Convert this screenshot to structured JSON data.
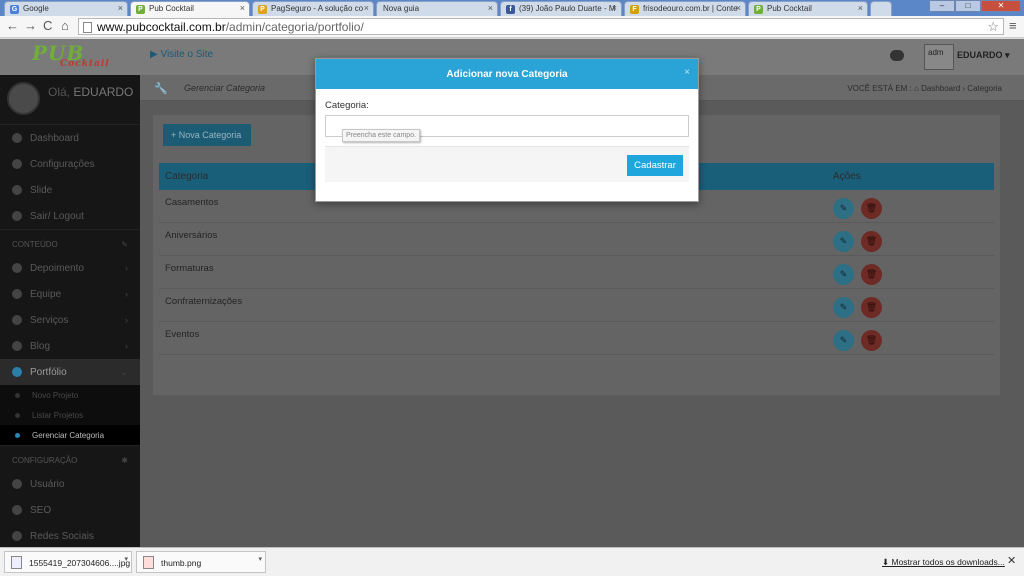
{
  "browser": {
    "tabs": [
      {
        "title": "Google",
        "fav": "G",
        "color": "#4a7fe0"
      },
      {
        "title": "Pub Cocktail",
        "fav": "P",
        "color": "#6fae3a",
        "active": true
      },
      {
        "title": "PagSeguro - A solução co",
        "fav": "P",
        "color": "#e0a020"
      },
      {
        "title": "Nova guia",
        "fav": "",
        "color": "#999"
      },
      {
        "title": "(39) João Paulo Duarte - M",
        "fav": "f",
        "color": "#3b5998"
      },
      {
        "title": "frisodeouro.com.br | Conte",
        "fav": "F",
        "color": "#d4a010"
      },
      {
        "title": "Pub Cocktail",
        "fav": "P",
        "color": "#6fae3a"
      }
    ],
    "tab_close": "×",
    "url_host": "www.pubcocktail.com.br",
    "url_path": "/admin/categoria/portfolio/",
    "back_icon": "←",
    "forward_icon": "→",
    "reload_icon": "C",
    "home_icon": "⌂",
    "star_icon": "☆",
    "menu_icon": "≡",
    "win_min": "–",
    "win_max": "□",
    "win_close": "✕"
  },
  "topnav": {
    "logo": "PUB",
    "logo_sub": "Cocktail",
    "visit_site": "Visite o Site",
    "avatar_alt": "adm",
    "username": "EDUARDO ▾"
  },
  "sidebar": {
    "greeting": "Olá,",
    "name": "EDUARDO",
    "items": [
      {
        "label": "Dashboard"
      },
      {
        "label": "Configurações"
      },
      {
        "label": "Slide"
      },
      {
        "label": "Sair/ Logout"
      }
    ],
    "section_content": "CONTEÚDO",
    "content_items": [
      {
        "label": "Depoimento",
        "chev": "›"
      },
      {
        "label": "Equipe",
        "chev": "›"
      },
      {
        "label": "Serviços",
        "chev": "›"
      },
      {
        "label": "Blog",
        "chev": "›"
      }
    ],
    "portfolio": {
      "label": "Portfólio",
      "chev": "⌄"
    },
    "sub_items": [
      "Novo Projeto",
      "Listar Projetos",
      "Gerenciar Categoria"
    ],
    "section_config": "CONFIGURAÇÃO",
    "config_items": [
      {
        "label": "Usuário"
      },
      {
        "label": "SEO"
      },
      {
        "label": "Redes Sociais"
      }
    ]
  },
  "page": {
    "title": "Gerenciar Categoria",
    "breadcrumb": "VOCÊ ESTÁ EM :  ⌂ Dashboard  ›  Categoria",
    "new_button": "+ Nova Categoria",
    "table": {
      "headers": [
        "Categoria",
        "Ações"
      ],
      "rows": [
        "Casamentos",
        "Aniversários",
        "Formaturas",
        "Confraternizações",
        "Eventos"
      ]
    },
    "edit_icon": "✎",
    "delete_icon": "🗑"
  },
  "modal": {
    "title": "Adicionar nova Categoria",
    "close": "×",
    "label": "Categoria:",
    "input_value": "",
    "tooltip": "Preencha este campo.",
    "submit": "Cadastrar"
  },
  "downloads": {
    "items": [
      "1555419_207304606....jpg",
      "thumb.png"
    ],
    "dropdown": "▾",
    "show_all": "Mostrar todos os downloads...",
    "close": "✕"
  }
}
